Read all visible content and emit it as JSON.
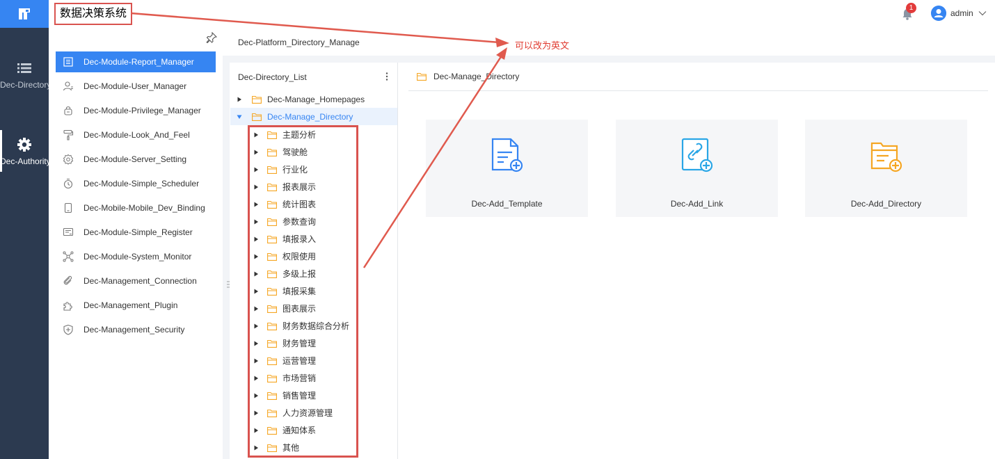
{
  "app": {
    "system_title": "数据决策系统",
    "rail": [
      {
        "label": "Dec-Directory",
        "icon": "list-icon"
      },
      {
        "label": "Dec-Authority",
        "icon": "gear-icon"
      }
    ]
  },
  "header": {
    "notification_count": "1",
    "user_name": "admin"
  },
  "menu": {
    "items": [
      {
        "label": "Dec-Module-Report_Manager",
        "icon": "report-icon",
        "active": true
      },
      {
        "label": "Dec-Module-User_Manager",
        "icon": "user-icon"
      },
      {
        "label": "Dec-Module-Privilege_Manager",
        "icon": "lock-icon"
      },
      {
        "label": "Dec-Module-Look_And_Feel",
        "icon": "paint-roller-icon"
      },
      {
        "label": "Dec-Module-Server_Setting",
        "icon": "gear-outline-icon"
      },
      {
        "label": "Dec-Module-Simple_Scheduler",
        "icon": "timer-icon"
      },
      {
        "label": "Dec-Mobile-Mobile_Dev_Binding",
        "icon": "mobile-icon"
      },
      {
        "label": "Dec-Module-Simple_Register",
        "icon": "register-icon"
      },
      {
        "label": "Dec-Module-System_Monitor",
        "icon": "monitor-icon"
      },
      {
        "label": "Dec-Management_Connection",
        "icon": "connection-icon"
      },
      {
        "label": "Dec-Management_Plugin",
        "icon": "plugin-icon"
      },
      {
        "label": "Dec-Management_Security",
        "icon": "shield-icon"
      }
    ]
  },
  "breadcrumb": "Dec-Platform_Directory_Manage",
  "annotation": "可以改为英文",
  "tree": {
    "title": "Dec-Directory_List",
    "roots": [
      {
        "label": "Dec-Manage_Homepages",
        "expanded": false
      },
      {
        "label": "Dec-Manage_Directory",
        "expanded": true,
        "selected": true
      }
    ],
    "children": [
      "主题分析",
      "驾驶舱",
      "行业化",
      "报表展示",
      "统计图表",
      "参数查询",
      "填报录入",
      "权限使用",
      "多级上报",
      "填报采集",
      "图表展示",
      "财务数据综合分析",
      "财务管理",
      "运营管理",
      "市场营销",
      "销售管理",
      "人力资源管理",
      "通知体系",
      "其他"
    ]
  },
  "content": {
    "current_folder": "Dec-Manage_Directory",
    "cards": [
      {
        "label": "Dec-Add_Template",
        "icon": "add-template-icon",
        "color": "#3685f2"
      },
      {
        "label": "Dec-Add_Link",
        "icon": "add-link-icon",
        "color": "#2aa6e6"
      },
      {
        "label": "Dec-Add_Directory",
        "icon": "add-directory-icon",
        "color": "#f5a623"
      }
    ]
  },
  "colors": {
    "accent": "#3685f2",
    "rail": "#2c3a50",
    "folder": "#f5a623",
    "annotation": "#e03a2f"
  }
}
